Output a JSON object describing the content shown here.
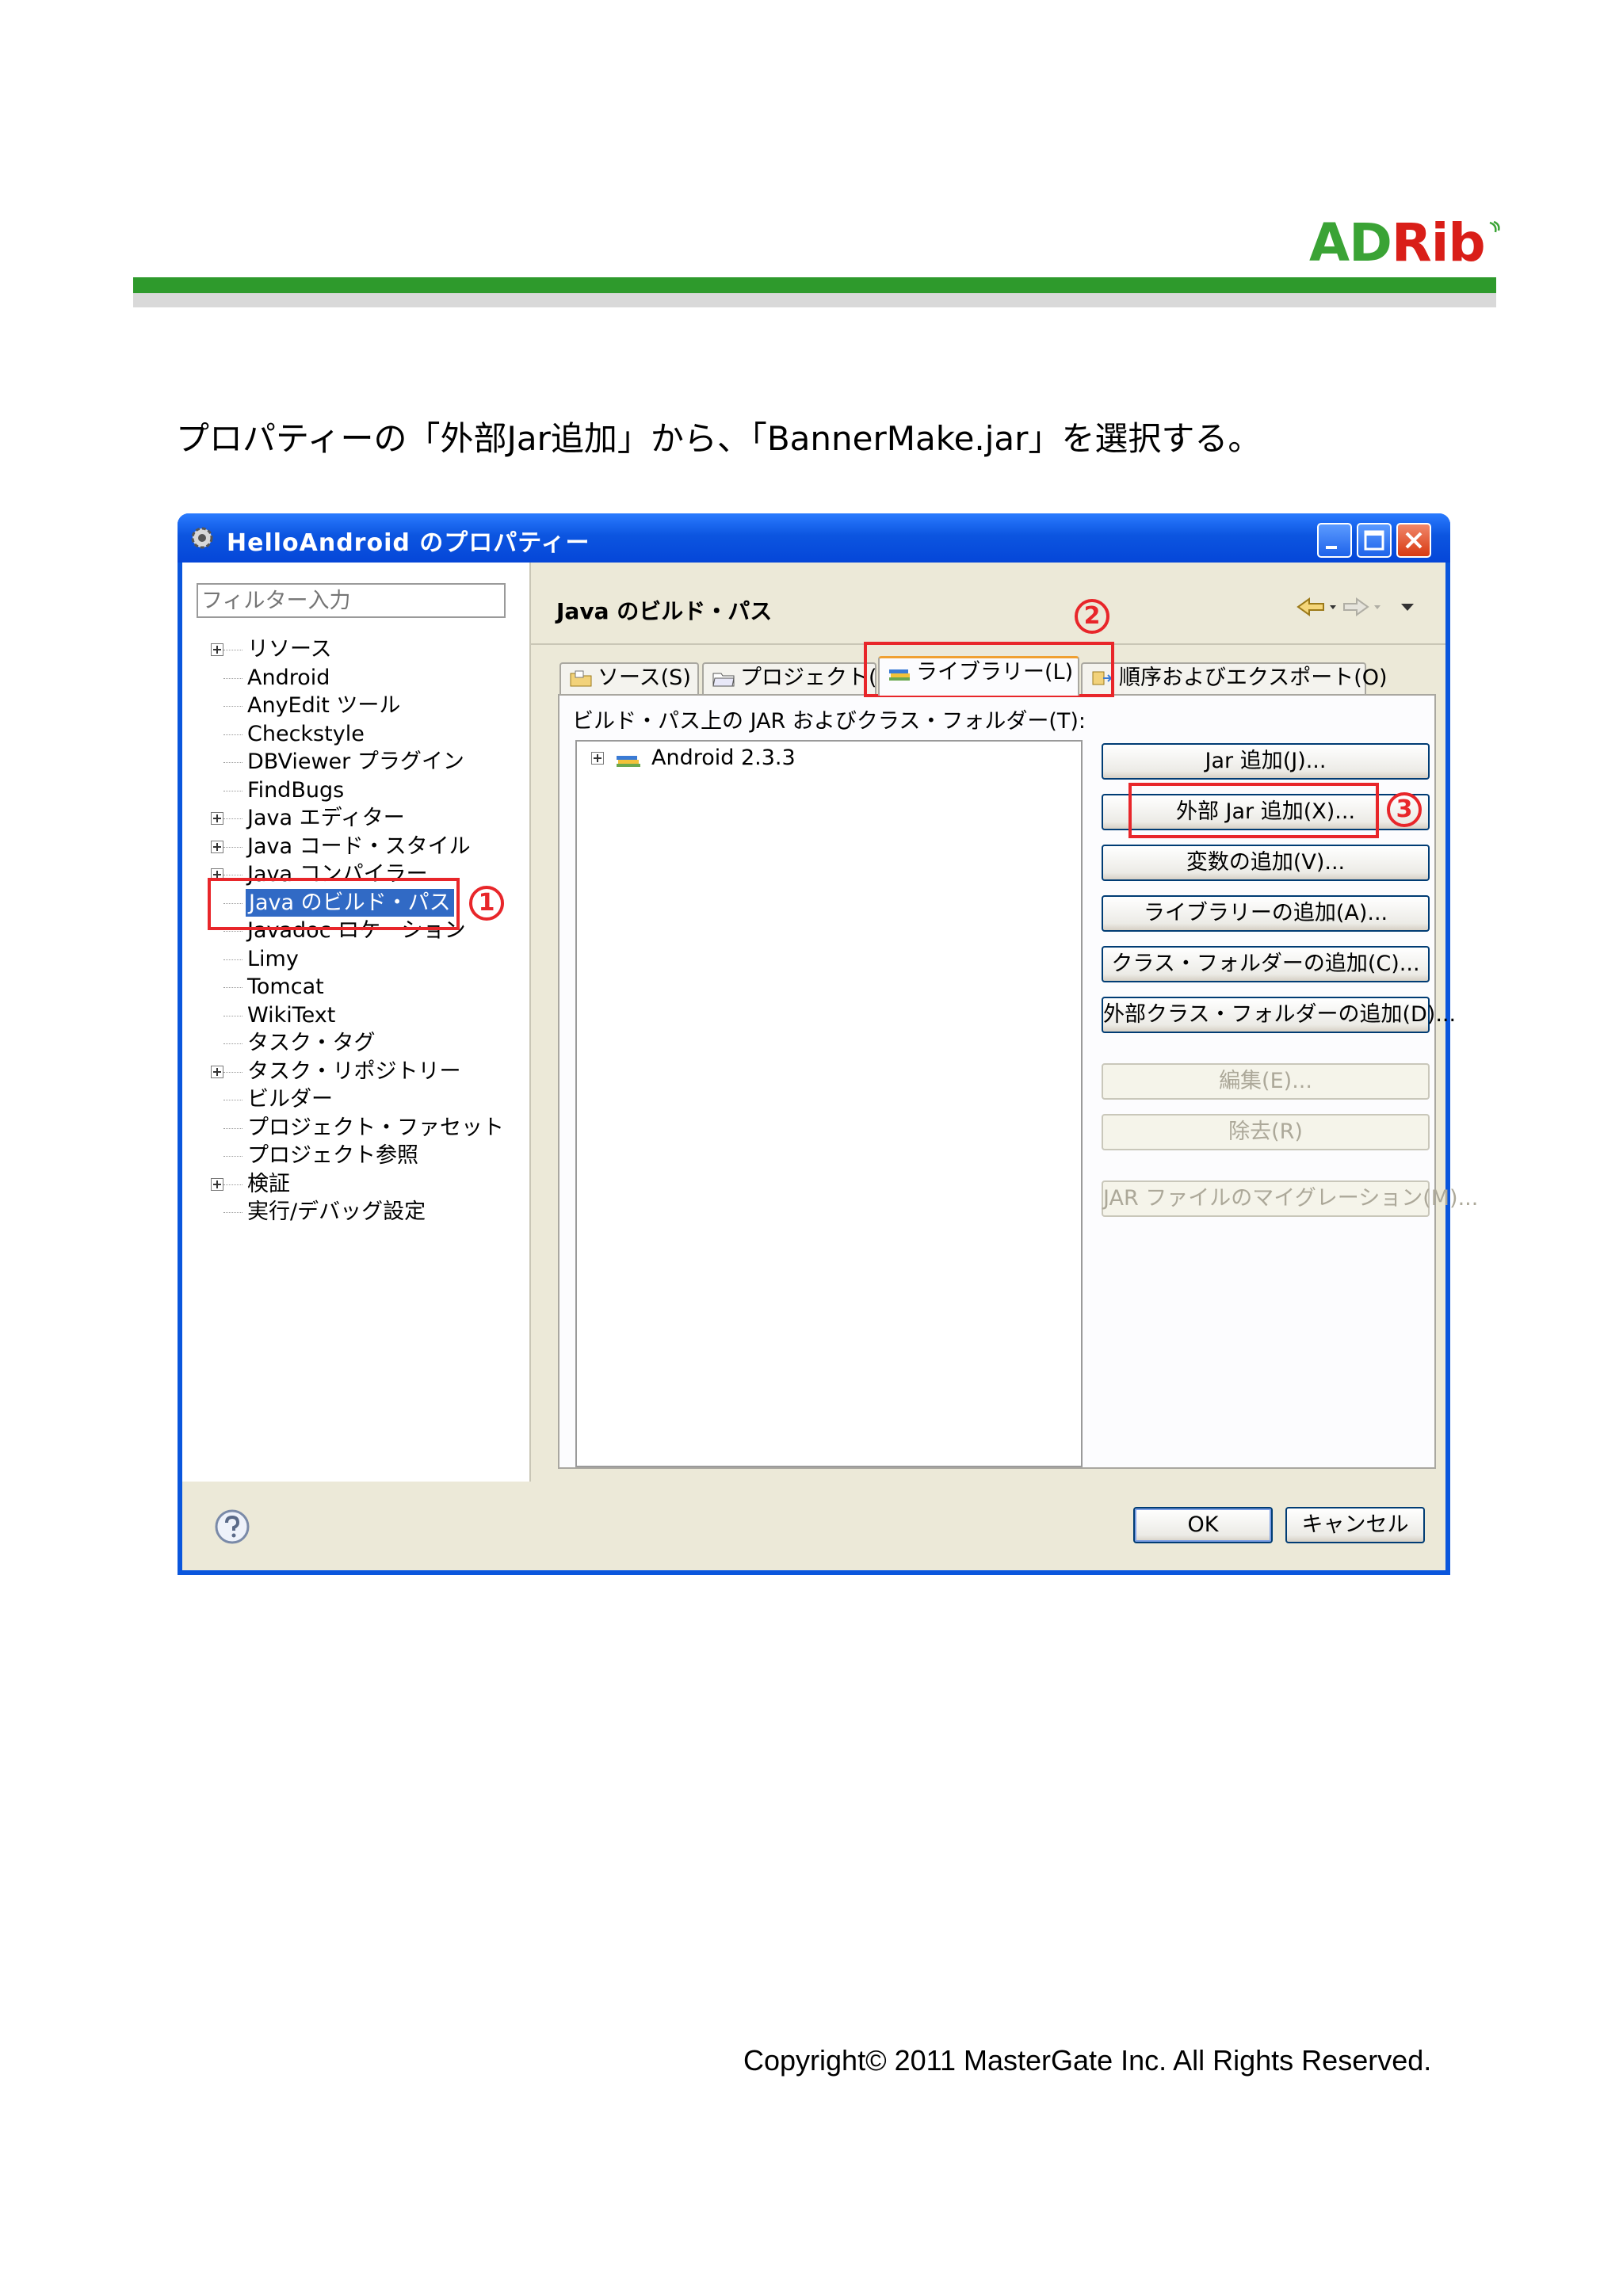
{
  "logo": {
    "part1": "AD",
    "part2": "Rib",
    "colors": {
      "green": "#3aa335",
      "red": "#d91e18"
    }
  },
  "instruction": "プロパティーの「外部Jar追加」から、「BannerMake.jar」を選択する。",
  "dialog": {
    "title": "HelloAndroid のプロパティー",
    "filter_placeholder": "フィルター入力",
    "tree": [
      {
        "label": "リソース",
        "expandable": true
      },
      {
        "label": "Android",
        "expandable": false
      },
      {
        "label": "AnyEdit ツール",
        "expandable": false
      },
      {
        "label": "Checkstyle",
        "expandable": false
      },
      {
        "label": "DBViewer プラグイン",
        "expandable": false
      },
      {
        "label": "FindBugs",
        "expandable": false
      },
      {
        "label": "Java エディター",
        "expandable": true
      },
      {
        "label": "Java コード・スタイル",
        "expandable": true
      },
      {
        "label": "Java コンパイラー",
        "expandable": true
      },
      {
        "label": "Java のビルド・パス",
        "expandable": false,
        "selected": true
      },
      {
        "label": "Javadoc ロケーション",
        "expandable": false
      },
      {
        "label": "Limy",
        "expandable": false
      },
      {
        "label": "Tomcat",
        "expandable": false
      },
      {
        "label": "WikiText",
        "expandable": false
      },
      {
        "label": "タスク・タグ",
        "expandable": false
      },
      {
        "label": "タスク・リポジトリー",
        "expandable": true
      },
      {
        "label": "ビルダー",
        "expandable": false
      },
      {
        "label": "プロジェクト・ファセット",
        "expandable": false
      },
      {
        "label": "プロジェクト参照",
        "expandable": false
      },
      {
        "label": "検証",
        "expandable": true
      },
      {
        "label": "実行/デバッグ設定",
        "expandable": false
      }
    ],
    "page_title": "Java のビルド・パス",
    "tabs": [
      "ソース(S)",
      "プロジェクト(P)",
      "ライブラリー(L)",
      "順序およびエクスポート(O)"
    ],
    "active_tab": "ライブラリー(L)",
    "libraries_caption": "ビルド・パス上の JAR およびクラス・フォルダー(T):",
    "libraries": [
      "Android 2.3.3"
    ],
    "buttons": {
      "add_jar": "Jar 追加(J)...",
      "add_external_jar": "外部 Jar 追加(X)...",
      "add_variable": "変数の追加(V)...",
      "add_library": "ライブラリーの追加(A)...",
      "add_class_folder": "クラス・フォルダーの追加(C)...",
      "add_external_class_folder": "外部クラス・フォルダーの追加(D)...",
      "edit": "編集(E)...",
      "remove": "除去(R)",
      "migrate_jar": "JAR ファイルのマイグレーション(M)..."
    },
    "ok": "OK",
    "cancel": "キャンセル"
  },
  "annotations": {
    "step1": "1",
    "step2": "2",
    "step3": "3",
    "color": "#e8262a"
  },
  "copyright": "Copyright© 2011 MasterGate Inc. All Rights Reserved."
}
